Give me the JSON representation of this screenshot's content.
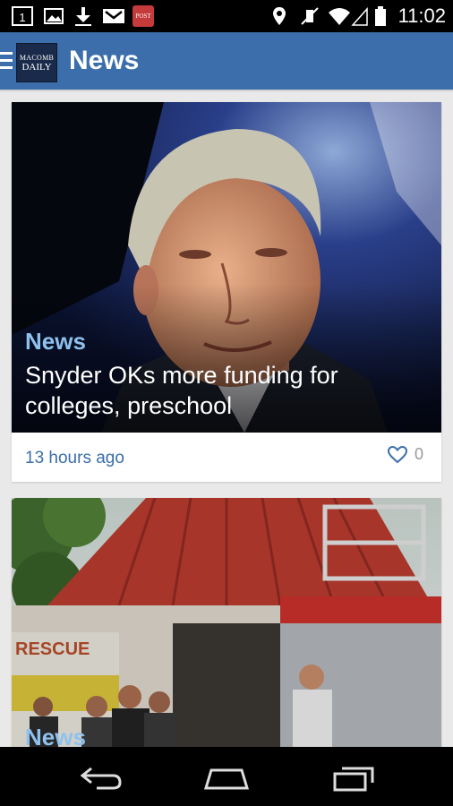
{
  "status_bar": {
    "time": "11:02",
    "notification_icons": [
      "calendar-icon",
      "image-icon",
      "download-icon",
      "gmail-icon",
      "app-notification-icon"
    ],
    "app_notification_text": "POST",
    "system_icons": [
      "location-icon",
      "mute-icon",
      "wifi-icon",
      "signal-icon",
      "battery-icon"
    ]
  },
  "app_bar": {
    "logo_line1": "MACOMB",
    "logo_line2": "DAILY",
    "title": "News",
    "colors": {
      "bar": "#3b6eaa"
    }
  },
  "articles": [
    {
      "category": "News",
      "headline": "Snyder OKs more funding for colleges, preschool",
      "timestamp": "13 hours ago",
      "likes": "0"
    },
    {
      "category": "News",
      "rescue_sign": "RESCUE"
    }
  ],
  "nav_bar": {
    "buttons": [
      "back-icon",
      "home-icon",
      "recent-apps-icon"
    ]
  }
}
